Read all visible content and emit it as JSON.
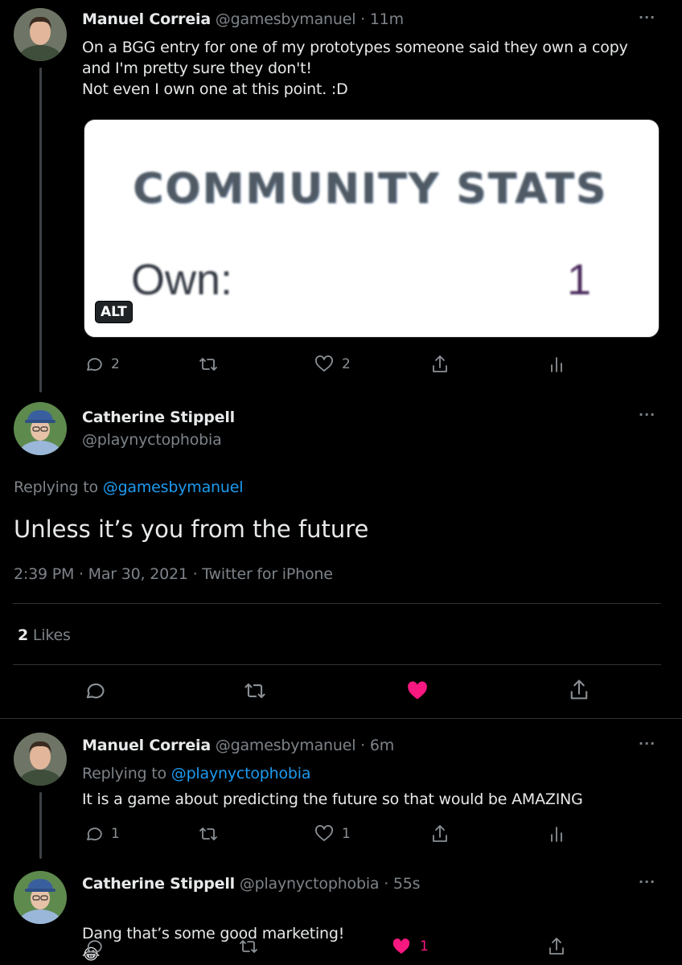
{
  "tweets": [
    {
      "name": "Manuel Correia",
      "handle": "@gamesbymanuel",
      "time": "· 11m",
      "text": "On a BGG entry for one of my prototypes someone said they own a copy\nand I'm pretty sure they don't!\nNot even I own one at this point. :D",
      "replies": "2",
      "likes": "2"
    },
    {
      "name": "Catherine Stippell",
      "handle": "@playnyctophobia",
      "replying_prefix": "Replying to ",
      "replying_to": "@gamesbymanuel",
      "text": "Unless it’s you from the future",
      "meta": "2:39 PM · Mar 30, 2021 · Twitter for iPhone",
      "like_count": "2",
      "like_label": " Likes"
    },
    {
      "name": "Manuel Correia",
      "handle": "@gamesbymanuel",
      "time": "· 6m",
      "replying_prefix": "Replying to ",
      "replying_to": "@playnyctophobia",
      "text": "It is a game about predicting the future so that would be AMAZING",
      "replies": "1",
      "likes": "1"
    },
    {
      "name": "Catherine Stippell",
      "handle": "@playnyctophobia",
      "time": "· 55s",
      "text": "Dang that’s some good marketing!",
      "emoji": "😂",
      "likes": "1"
    }
  ],
  "media": {
    "stats_title": "COMMUNITY STATS",
    "own_label": "Own:",
    "own_value": "1",
    "alt_badge": "ALT"
  },
  "more_label": "···",
  "colors": {
    "accent": "#1d9bf0",
    "like": "#f91880",
    "background": "#000000"
  }
}
